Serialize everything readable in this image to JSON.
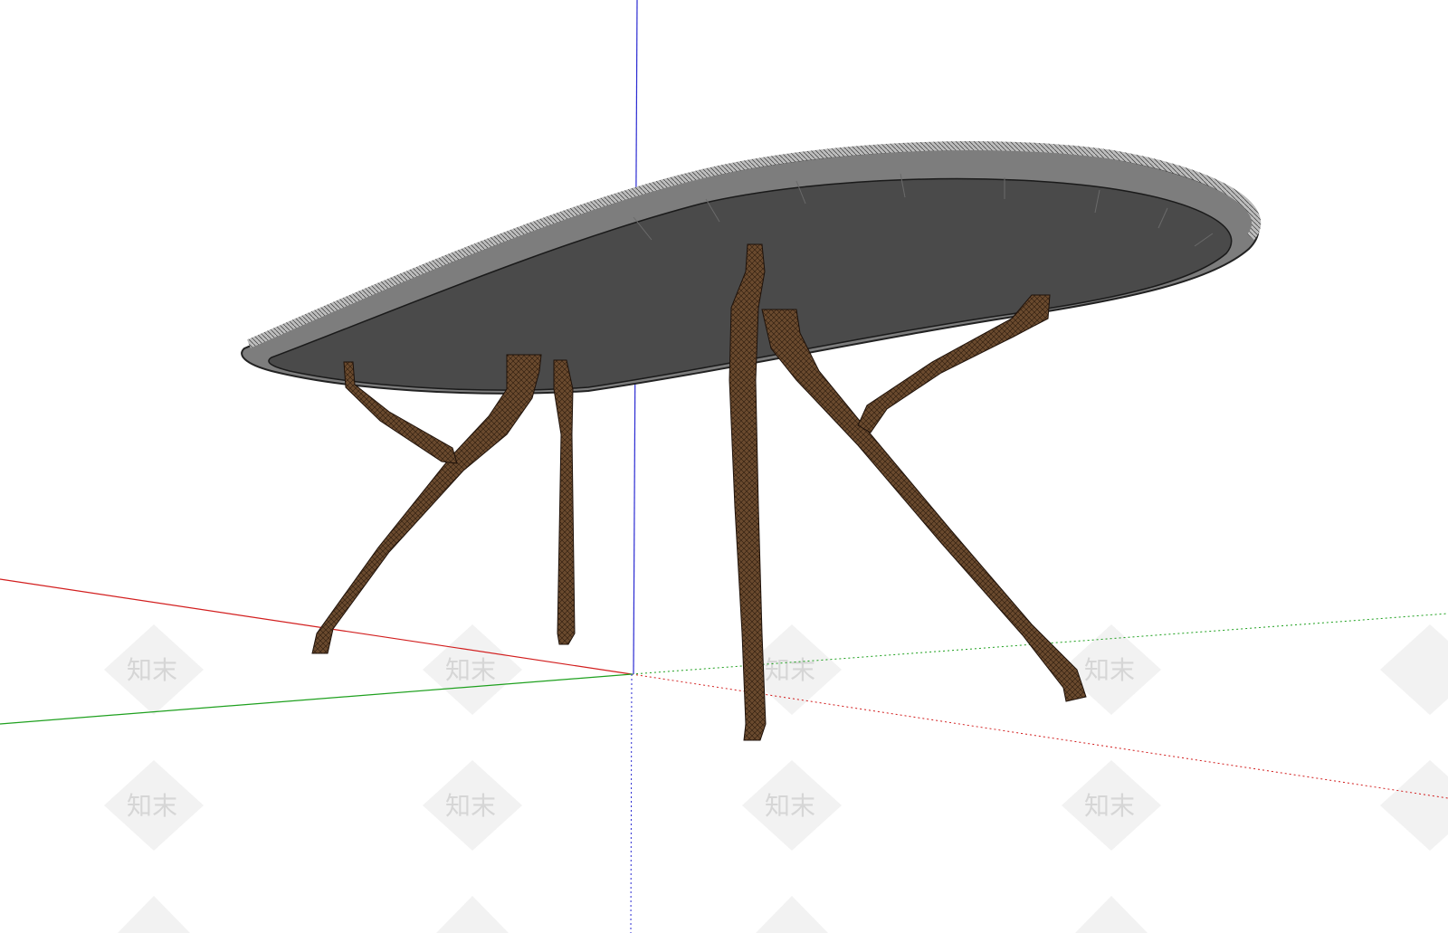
{
  "app": {
    "view": "3D modeling viewport"
  },
  "scene": {
    "model": "oval table with four splayed legs",
    "tabletop_color": "#4a4a4a",
    "tabletop_rim_color": "#8a8a8a",
    "leg_color": "#5c3d24",
    "axis_colors": {
      "red": "#d21e1e",
      "green": "#1ea01e",
      "blue": "#2a2ad2"
    }
  },
  "watermark": {
    "text": "知末"
  }
}
